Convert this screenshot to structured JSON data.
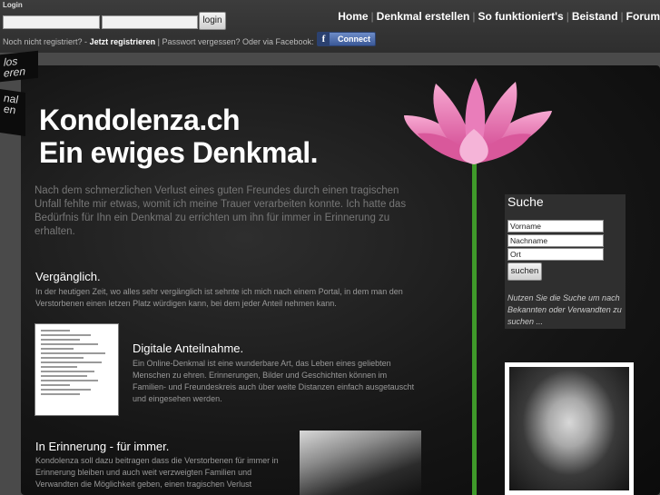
{
  "login": {
    "label": "Login",
    "username_value": "",
    "password_value": "",
    "button": "login",
    "not_registered": "Noch nicht registriert? -",
    "register_now": "Jetzt registrieren",
    "separator": "|",
    "forgot_password": "Passwort vergessen?",
    "or_via_facebook": "Oder via Facebook:",
    "fb_icon": "f",
    "fb_connect": "Connect"
  },
  "nav": {
    "items": [
      "Home",
      "Denkmal erstellen",
      "So funktioniert's",
      "Beistand",
      "Forum"
    ],
    "sep": "|"
  },
  "ribbons": {
    "top": [
      "los",
      "eren"
    ],
    "bottom": [
      "nal",
      "en"
    ]
  },
  "hero": {
    "title_line1": "Kondolenza.ch",
    "title_line2": "Ein ewiges Denkmal.",
    "intro": "Nach dem schmerzlichen Verlust eines guten Freundes durch einen tragischen Unfall fehlte mir etwas, womit ich meine Trauer verarbeiten konnte. Ich hatte das Bedürfnis für Ihn ein Denkmal zu errichten um ihn für immer in Erinnerung zu erhalten."
  },
  "sections": {
    "s1_title": "Vergänglich.",
    "s1_text": "In der heutigen Zeit, wo alles sehr vergänglich ist sehnte ich mich nach einem Portal, in dem man den Verstorbenen einen letzen Platz würdigen kann, bei dem jeder Anteil nehmen kann.",
    "s2_title": "Digitale Anteilnahme.",
    "s2_text": "Ein Online-Denkmal ist eine wunderbare Art, das Leben eines geliebten Menschen zu ehren. Erinnerungen, Bilder und Geschichten können im Familien- und Freundeskreis auch über weite Distanzen einfach ausgetauscht und eingesehen werden.",
    "s3_title": "In Erinnerung - für immer.",
    "s3_text": "Kondolenza soll dazu beitragen dass die Verstorbenen für immer in Erinnerung bleiben und auch weit verzweigten Familien und Verwandten die Möglichkeit geben, einen tragischen Verlust"
  },
  "search": {
    "title": "Suche",
    "firstname": "Vorname",
    "lastname": "Nachname",
    "place": "Ort",
    "button": "suchen",
    "hint": "Nutzen Sie die Suche um nach Bekannten oder Verwandten zu suchen ..."
  },
  "colors": {
    "page_bg": "#4a4a4a",
    "panel_bg": "#151515",
    "lotus_pink": "#e77ab2",
    "stem_green": "#3f9a2a",
    "facebook_blue": "#3b5998"
  },
  "icons": {
    "facebook": "facebook-icon",
    "lotus": "lotus-flower-image"
  }
}
